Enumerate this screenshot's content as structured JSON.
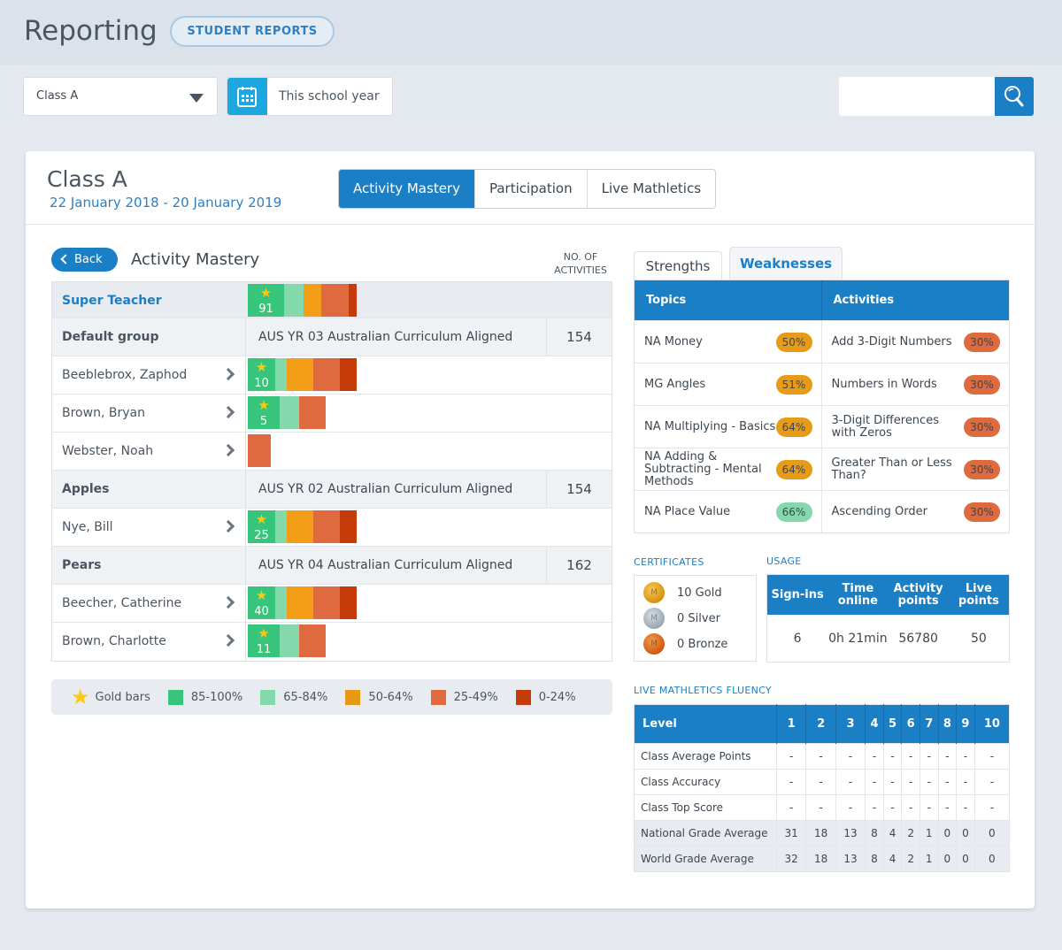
{
  "header": {
    "title": "Reporting",
    "student_reports_label": "STUDENT REPORTS"
  },
  "filters": {
    "class_value": "Class A",
    "date_range_value": "This school year",
    "search_placeholder": ""
  },
  "card": {
    "class_name": "Class A",
    "date_range": "22 January 2018 - 20 January 2019",
    "tabs": [
      {
        "label": "Activity Mastery",
        "active": true
      },
      {
        "label": "Participation",
        "active": false
      },
      {
        "label": "Live Mathletics",
        "active": false
      }
    ]
  },
  "mastery": {
    "back_label": "Back",
    "title": "Activity Mastery",
    "count_header": "NO. OF ACTIVITIES",
    "colors": {
      "85-100": "#36c57a",
      "65-84": "#84d9ac",
      "50-64": "#f49e17",
      "25-49": "#e06a40",
      "0-24": "#c43a08",
      "star": "#ffc812"
    },
    "rows": [
      {
        "type": "teacher",
        "name": "Super Teacher",
        "gold_bars": "91",
        "segments": [
          41,
          22,
          20,
          31,
          9
        ]
      },
      {
        "type": "group",
        "name": "Default group",
        "curriculum": "AUS YR 03 Australian Curriculum Aligned",
        "activities": "154"
      },
      {
        "type": "student",
        "name": "Beeblebrox, Zaphod",
        "gold_bars": "10",
        "segments": [
          31,
          13,
          30,
          30,
          19
        ]
      },
      {
        "type": "student",
        "name": "Brown, Bryan",
        "gold_bars": "5",
        "segments": [
          36,
          22,
          0,
          30,
          0
        ]
      },
      {
        "type": "student",
        "name": "Webster, Noah",
        "gold_bars": "",
        "segments": [
          0,
          0,
          0,
          26,
          0
        ]
      },
      {
        "type": "group",
        "name": "Apples",
        "curriculum": "AUS YR 02 Australian Curriculum Aligned",
        "activities": "154"
      },
      {
        "type": "student",
        "name": "Nye, Bill",
        "gold_bars": "25",
        "segments": [
          31,
          13,
          30,
          30,
          19
        ]
      },
      {
        "type": "group",
        "name": "Pears",
        "curriculum": "AUS YR 04 Australian Curriculum Aligned",
        "activities": "162"
      },
      {
        "type": "student",
        "name": "Beecher, Catherine",
        "gold_bars": "40",
        "segments": [
          31,
          13,
          30,
          30,
          19
        ]
      },
      {
        "type": "student",
        "name": "Brown, Charlotte",
        "gold_bars": "11",
        "segments": [
          36,
          22,
          0,
          30,
          0
        ]
      }
    ],
    "legend": [
      {
        "label": "Gold bars",
        "kind": "star"
      },
      {
        "label": "85-100%",
        "color": "#36c57a"
      },
      {
        "label": "65-84%",
        "color": "#84d9ac"
      },
      {
        "label": "50-64%",
        "color": "#e49a14"
      },
      {
        "label": "25-49%",
        "color": "#e06a40"
      },
      {
        "label": "0-24%",
        "color": "#c43a08"
      }
    ]
  },
  "strengths_weaknesses": {
    "tabs": [
      {
        "label": "Strengths",
        "active": false
      },
      {
        "label": "Weaknesses",
        "active": true
      }
    ],
    "headers": {
      "topics": "Topics",
      "activities": "Activities"
    },
    "rows": [
      {
        "topic": "NA Money",
        "topic_pct": "50%",
        "topic_color": "#e89b16",
        "activity": "Add 3-Digit Numbers",
        "activity_pct": "30%",
        "activity_color": "#e06a40"
      },
      {
        "topic": "MG Angles",
        "topic_pct": "51%",
        "topic_color": "#e89b16",
        "activity": "Numbers in Words",
        "activity_pct": "30%",
        "activity_color": "#e06a40"
      },
      {
        "topic": "NA Multiplying - Basics",
        "topic_pct": "64%",
        "topic_color": "#e89b16",
        "activity": "3-Digit Differences with Zeros",
        "activity_pct": "30%",
        "activity_color": "#e06a40"
      },
      {
        "topic": "NA Adding & Subtracting - Mental Methods",
        "topic_pct": "64%",
        "topic_color": "#e89b16",
        "activity": "Greater Than or Less Than?",
        "activity_pct": "30%",
        "activity_color": "#e06a40"
      },
      {
        "topic": "NA Place Value",
        "topic_pct": "66%",
        "topic_color": "#84d9ac",
        "activity": "Ascending Order",
        "activity_pct": "30%",
        "activity_color": "#e06a40"
      }
    ]
  },
  "certificates": {
    "label": "CERTIFICATES",
    "items": [
      {
        "label": "10 Gold",
        "medal": "gold"
      },
      {
        "label": "0 Silver",
        "medal": "silver"
      },
      {
        "label": "0 Bronze",
        "medal": "bronze"
      }
    ]
  },
  "usage": {
    "label": "USAGE",
    "headers": [
      "Sign-ins",
      "Time online",
      "Activity points",
      "Live points"
    ],
    "values": [
      "6",
      "0h 21min",
      "56780",
      "50"
    ]
  },
  "fluency": {
    "label": "LIVE MATHLETICS FLUENCY",
    "level_header": "Level",
    "levels": [
      "1",
      "2",
      "3",
      "4",
      "5",
      "6",
      "7",
      "8",
      "9",
      "10"
    ],
    "rows": [
      {
        "label": "Class Average Points",
        "values": [
          "-",
          "-",
          "-",
          "-",
          "-",
          "-",
          "-",
          "-",
          "-",
          "-"
        ],
        "shaded": false
      },
      {
        "label": "Class Accuracy",
        "values": [
          "-",
          "-",
          "-",
          "-",
          "-",
          "-",
          "-",
          "-",
          "-",
          "-"
        ],
        "shaded": false
      },
      {
        "label": "Class Top Score",
        "values": [
          "-",
          "-",
          "-",
          "-",
          "-",
          "-",
          "-",
          "-",
          "-",
          "-"
        ],
        "shaded": false
      },
      {
        "label": "National Grade Average",
        "values": [
          "31",
          "18",
          "13",
          "8",
          "4",
          "2",
          "1",
          "0",
          "0",
          "0"
        ],
        "shaded": true
      },
      {
        "label": "World Grade Average",
        "values": [
          "32",
          "18",
          "13",
          "8",
          "4",
          "2",
          "1",
          "0",
          "0",
          "0"
        ],
        "shaded": true
      }
    ]
  }
}
